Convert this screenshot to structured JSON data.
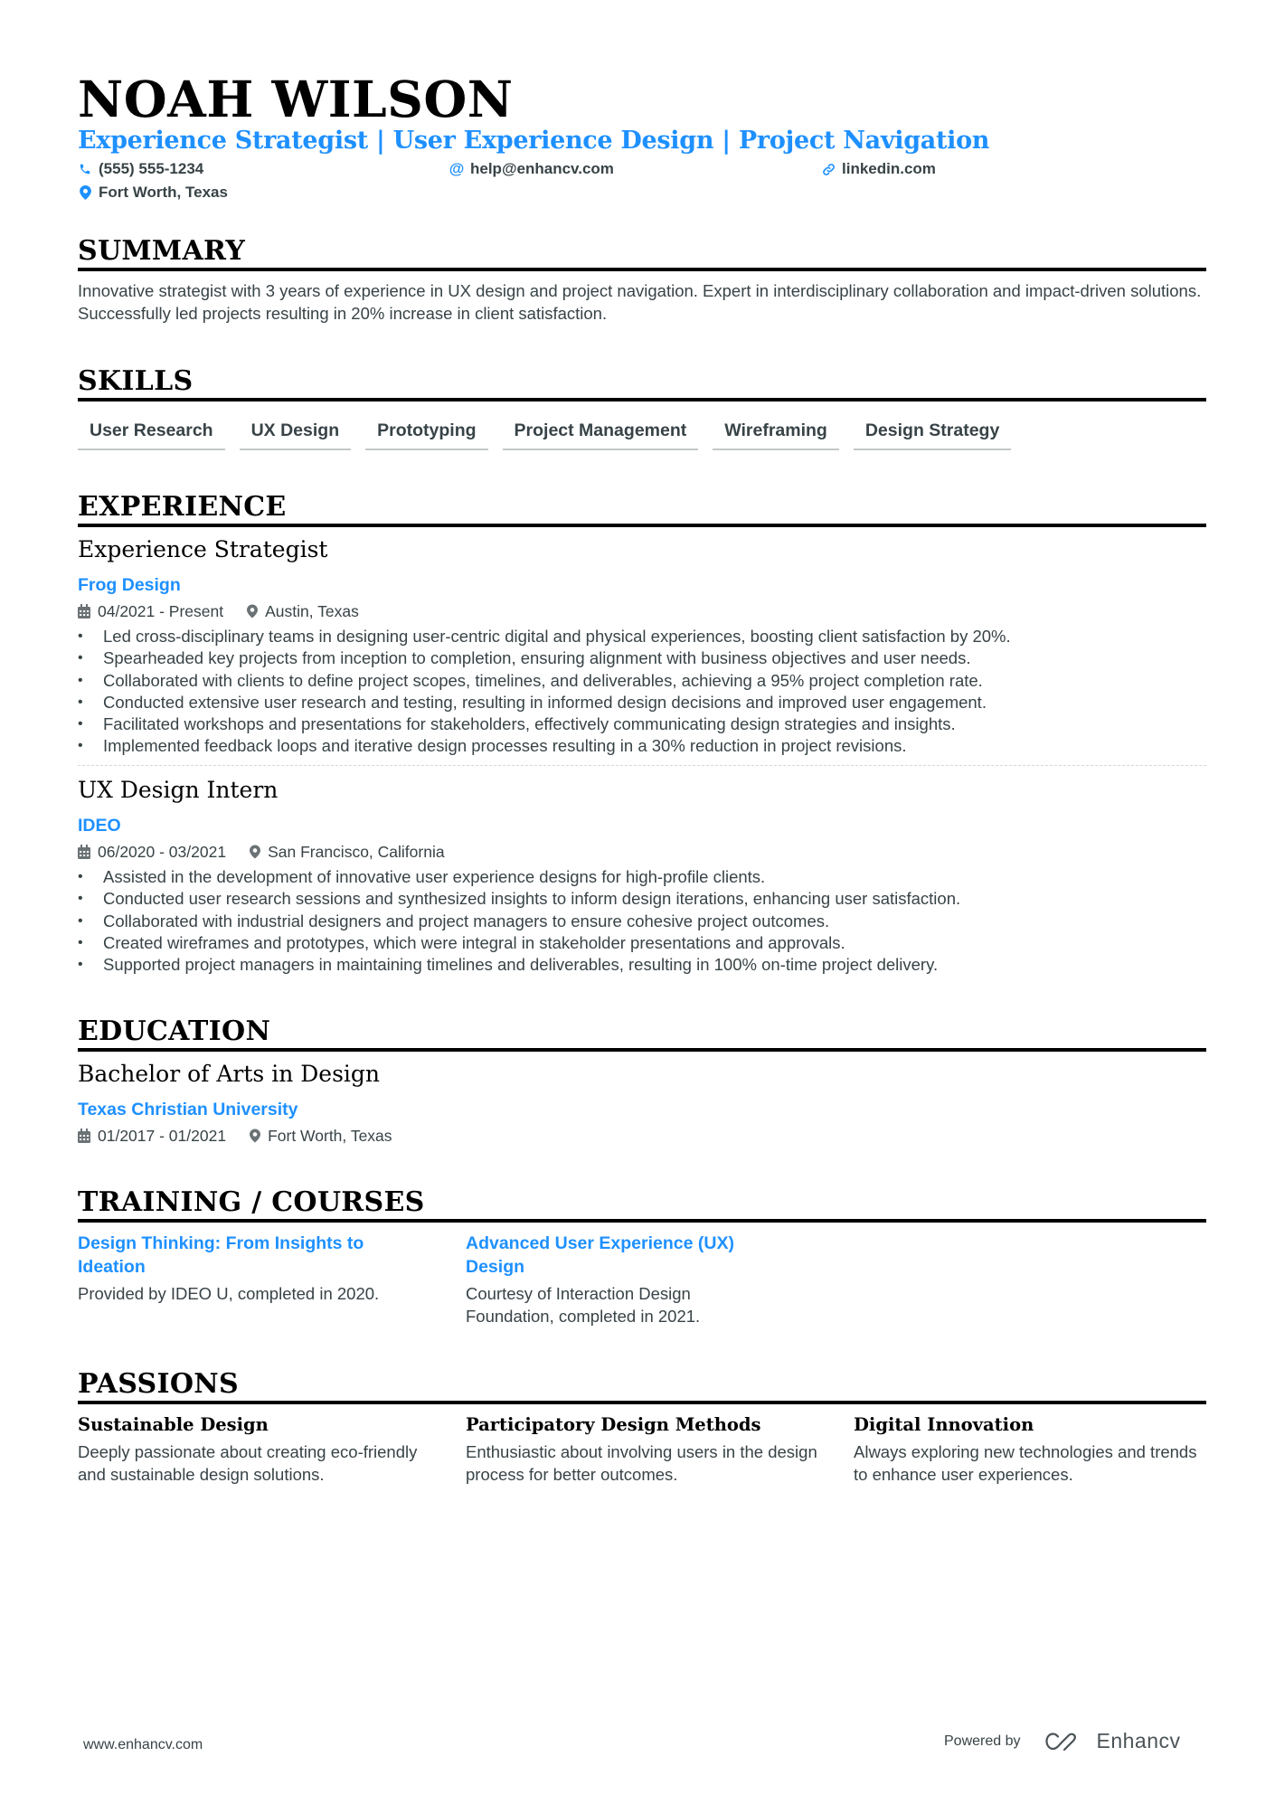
{
  "header": {
    "name": "NOAH WILSON",
    "headline": "Experience Strategist | User Experience Design | Project Navigation",
    "contacts": {
      "phone": {
        "icon": "phone-icon",
        "value": "(555) 555-1234"
      },
      "email": {
        "icon": "at-icon",
        "value": "help@enhancv.com"
      },
      "linkedin": {
        "icon": "link-icon",
        "value": "linkedin.com"
      },
      "location": {
        "icon": "location-pin-icon",
        "value": "Fort Worth, Texas"
      }
    }
  },
  "summary": {
    "title": "SUMMARY",
    "text": "Innovative strategist with 3 years of experience in UX design and project navigation. Expert in interdisciplinary collaboration and impact-driven solutions. Successfully led projects resulting in 20% increase in client satisfaction."
  },
  "skills": {
    "title": "SKILLS",
    "items": [
      "User Research",
      "UX Design",
      "Prototyping",
      "Project Management",
      "Wireframing",
      "Design Strategy"
    ]
  },
  "experience": {
    "title": "EXPERIENCE",
    "jobs": [
      {
        "role": "Experience Strategist",
        "company": "Frog Design",
        "dates": "04/2021 - Present",
        "location": "Austin, Texas",
        "bullets": [
          "Led cross-disciplinary teams in designing user-centric digital and physical experiences, boosting client satisfaction by 20%.",
          "Spearheaded key projects from inception to completion, ensuring alignment with business objectives and user needs.",
          "Collaborated with clients to define project scopes, timelines, and deliverables, achieving a 95% project completion rate.",
          "Conducted extensive user research and testing, resulting in informed design decisions and improved user engagement.",
          "Facilitated workshops and presentations for stakeholders, effectively communicating design strategies and insights.",
          "Implemented feedback loops and iterative design processes resulting in a 30% reduction in project revisions."
        ]
      },
      {
        "role": "UX Design Intern",
        "company": "IDEO",
        "dates": "06/2020 - 03/2021",
        "location": "San Francisco, California",
        "bullets": [
          "Assisted in the development of innovative user experience designs for high-profile clients.",
          "Conducted user research sessions and synthesized insights to inform design iterations, enhancing user satisfaction.",
          "Collaborated with industrial designers and project managers to ensure cohesive project outcomes.",
          "Created wireframes and prototypes, which were integral in stakeholder presentations and approvals.",
          "Supported project managers in maintaining timelines and deliverables, resulting in 100% on-time project delivery."
        ]
      }
    ]
  },
  "education": {
    "title": "EDUCATION",
    "degree": "Bachelor of Arts in Design",
    "school": "Texas Christian University",
    "dates": "01/2017 - 01/2021",
    "location": "Fort Worth, Texas"
  },
  "training": {
    "title": "TRAINING / COURSES",
    "items": [
      {
        "title": "Design Thinking: From Insights to Ideation",
        "desc": "Provided by IDEO U, completed in 2020."
      },
      {
        "title": "Advanced User Experience (UX) Design",
        "desc": "Courtesy of Interaction Design Foundation, completed in 2021."
      }
    ]
  },
  "passions": {
    "title": "PASSIONS",
    "items": [
      {
        "title": "Sustainable Design",
        "desc": "Deeply passionate about creating eco-friendly and sustainable design solutions."
      },
      {
        "title": "Participatory Design Methods",
        "desc": "Enthusiastic about involving users in the design process for better outcomes."
      },
      {
        "title": "Digital Innovation",
        "desc": "Always exploring new technologies and trends to enhance user experiences."
      }
    ]
  },
  "footer": {
    "website": "www.enhancv.com",
    "powered_by": "Powered by",
    "brand": "Enhancv"
  },
  "colors": {
    "accent": "#1e90ff",
    "text": "#384347",
    "heading": "#000000"
  }
}
